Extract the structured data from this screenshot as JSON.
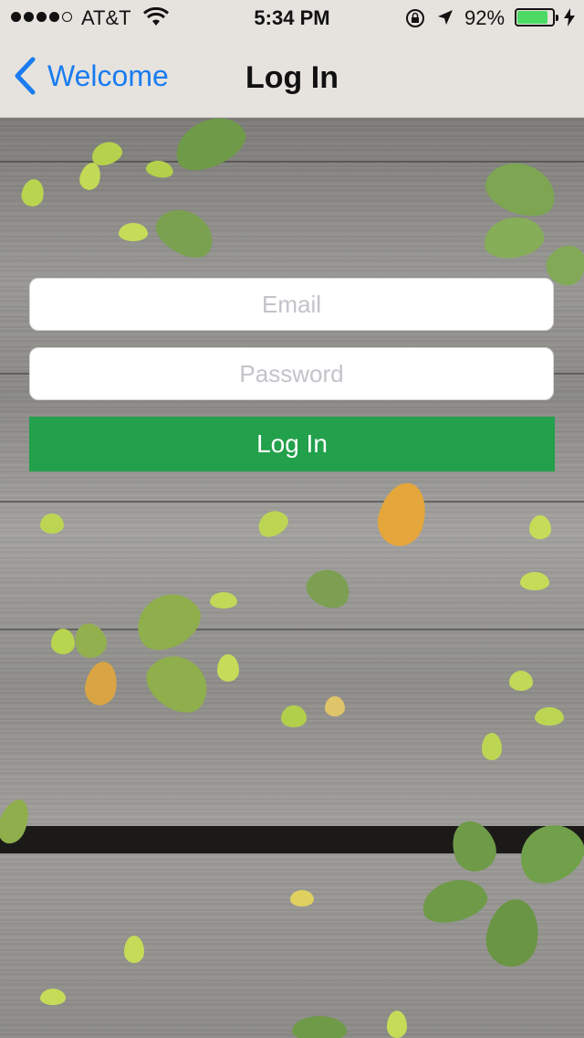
{
  "status_bar": {
    "signal_bars_filled": 4,
    "signal_bars_total": 5,
    "carrier": "AT&T",
    "time": "5:34 PM",
    "battery_percent": "92%",
    "battery_level": 0.92,
    "icons": [
      "wifi-icon",
      "rotation-lock-icon",
      "location-arrow-icon",
      "battery-icon",
      "charging-bolt-icon"
    ]
  },
  "nav": {
    "back_label": "Welcome",
    "title": "Log In"
  },
  "form": {
    "email_placeholder": "Email",
    "email_value": "",
    "password_placeholder": "Password",
    "password_value": "",
    "submit_label": "Log In"
  },
  "colors": {
    "accent_blue": "#1a7cf0",
    "login_green": "#23a04b",
    "battery_green": "#4cd964"
  }
}
